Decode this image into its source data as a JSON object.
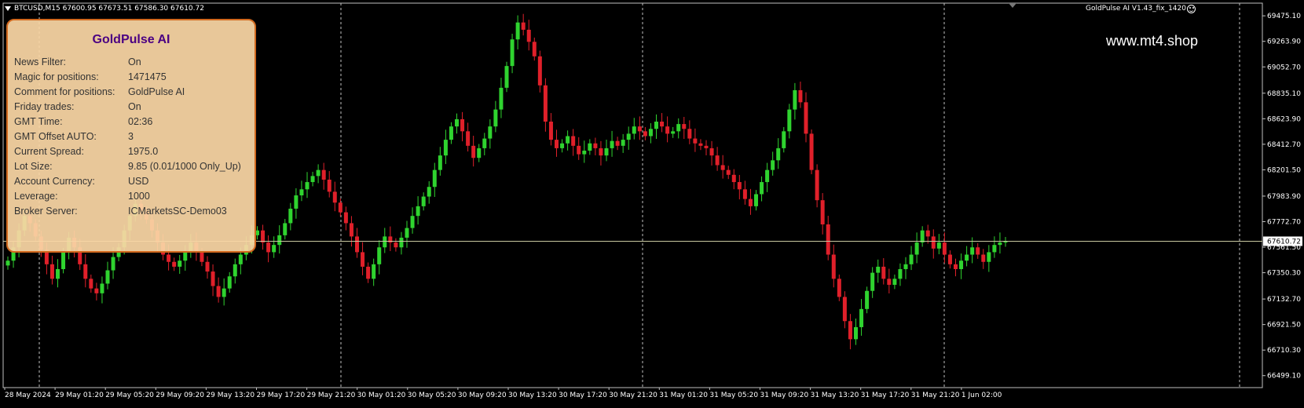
{
  "window": {
    "symbol_info": "BTCUSD,M15  67600.95 67673.51 67586.30 67610.72",
    "ea_label": "GoldPulse AI V1.43_fix_1420",
    "watermark": "www.mt4.shop"
  },
  "panel": {
    "title": "GoldPulse AI",
    "rows": [
      {
        "label": "News Filter:",
        "value": "On"
      },
      {
        "label": "Magic for positions:",
        "value": "1471475"
      },
      {
        "label": "Comment for positions:",
        "value": "GoldPulse AI"
      },
      {
        "label": "Friday trades:",
        "value": "On"
      },
      {
        "label": "GMT Time:",
        "value": "02:36"
      },
      {
        "label": "GMT Offset AUTO:",
        "value": "3"
      },
      {
        "label": "Current Spread:",
        "value": "1975.0"
      },
      {
        "label": "Lot Size:",
        "value": "9.85 (0.01/1000 Only_Up)"
      },
      {
        "label": "Account Currency:",
        "value": "USD"
      },
      {
        "label": "Leverage:",
        "value": "1000"
      },
      {
        "label": "Broker Server:",
        "value": "ICMarketsSC-Demo03"
      }
    ]
  },
  "chart_data": {
    "type": "candlestick",
    "symbol": "BTCUSD",
    "timeframe": "M15",
    "current_price": 67610.72,
    "ylim": [
      66400,
      69580
    ],
    "y_ticks": [
      "69475.10",
      "69263.90",
      "69052.70",
      "68835.10",
      "68623.90",
      "68412.70",
      "68201.50",
      "67983.90",
      "67772.70",
      "67561.50",
      "67350.30",
      "67132.70",
      "66921.50",
      "66710.30",
      "66499.10"
    ],
    "current_price_label": "67610.72",
    "x_ticks": [
      "28 May 2024",
      "29 May 01:20",
      "29 May 05:20",
      "29 May 09:20",
      "29 May 13:20",
      "29 May 17:20",
      "29 May 21:20",
      "30 May 01:20",
      "30 May 05:20",
      "30 May 09:20",
      "30 May 13:20",
      "30 May 17:20",
      "30 May 21:20",
      "31 May 01:20",
      "31 May 05:20",
      "31 May 09:20",
      "31 May 13:20",
      "31 May 17:20",
      "31 May 21:20",
      "1 Jun 02:00"
    ],
    "closes": [
      67450,
      67560,
      67700,
      67820,
      67760,
      67650,
      67540,
      67420,
      67300,
      67380,
      67520,
      67640,
      67560,
      67420,
      67300,
      67220,
      67180,
      67260,
      67370,
      67480,
      67560,
      67700,
      67820,
      67920,
      67860,
      67790,
      67700,
      67600,
      67500,
      67440,
      67400,
      67450,
      67520,
      67600,
      67520,
      67440,
      67360,
      67240,
      67150,
      67220,
      67320,
      67420,
      67500,
      67580,
      67660,
      67700,
      67600,
      67520,
      67580,
      67660,
      67760,
      67880,
      67990,
      68040,
      68100,
      68150,
      68200,
      68120,
      68020,
      67930,
      67850,
      67760,
      67650,
      67520,
      67400,
      67300,
      67420,
      67560,
      67650,
      67600,
      67560,
      67640,
      67720,
      67820,
      67900,
      67980,
      68060,
      68200,
      68320,
      68450,
      68560,
      68620,
      68520,
      68400,
      68300,
      68380,
      68460,
      68560,
      68700,
      68880,
      69060,
      69280,
      69420,
      69360,
      69260,
      69140,
      68900,
      68600,
      68450,
      68380,
      68420,
      68480,
      68400,
      68330,
      68360,
      68420,
      68380,
      68320,
      68380,
      68440,
      68400,
      68450,
      68500,
      68560,
      68520,
      68480,
      68540,
      68600,
      68560,
      68500,
      68520,
      68580,
      68540,
      68460,
      68420,
      68400,
      68380,
      68320,
      68240,
      68200,
      68160,
      68100,
      68040,
      67960,
      67900,
      68000,
      68100,
      68200,
      68280,
      68380,
      68520,
      68700,
      68860,
      68760,
      68500,
      68200,
      67950,
      67750,
      67500,
      67300,
      67150,
      66950,
      66800,
      66900,
      67050,
      67200,
      67350,
      67400,
      67300,
      67250,
      67300,
      67380,
      67420,
      67500,
      67600,
      67700,
      67650,
      67550,
      67600,
      67500,
      67420,
      67380,
      67450,
      67500,
      67560,
      67500,
      67440,
      67520,
      67580,
      67600,
      67610.72
    ]
  }
}
